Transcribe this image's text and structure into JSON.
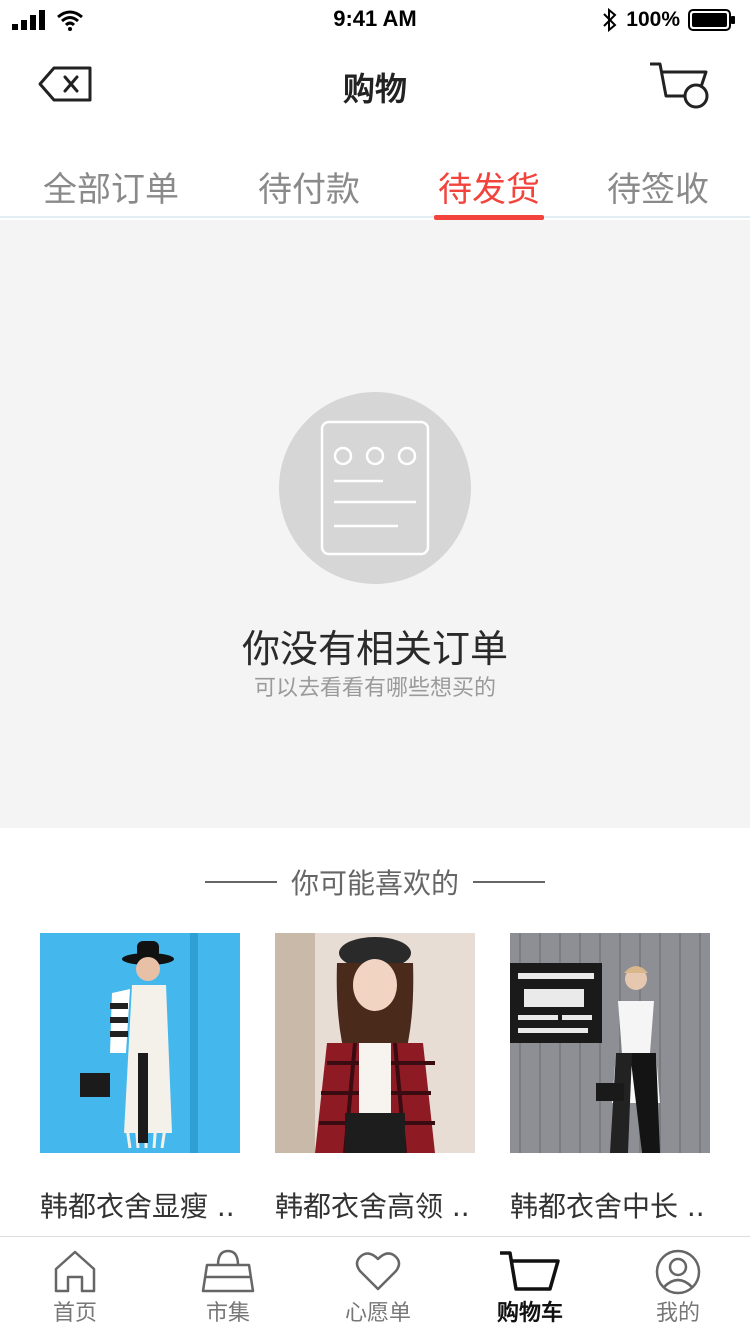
{
  "status_bar": {
    "time": "9:41 AM",
    "battery": "100%",
    "icons": [
      "signal-icon",
      "wifi-icon",
      "bluetooth-icon",
      "battery-icon"
    ]
  },
  "nav": {
    "title": "购物",
    "back_icon": "delete-back-icon",
    "cart_icon": "cart-icon"
  },
  "tabs": [
    {
      "label": "全部订单",
      "active": false
    },
    {
      "label": "待付款",
      "active": false
    },
    {
      "label": "待发货",
      "active": true
    },
    {
      "label": "待签收",
      "active": false
    }
  ],
  "empty": {
    "icon": "order-document-icon",
    "title": "你没有相关订单",
    "subtitle": "可以去看看有哪些想买的"
  },
  "recommend": {
    "title": "你可能喜欢的",
    "products": [
      {
        "name": "韩都衣舍显瘦 ..",
        "image": "fashion-photo-blue"
      },
      {
        "name": "韩都衣舍高领 ..",
        "image": "fashion-photo-plaid"
      },
      {
        "name": "韩都衣舍中长 ..",
        "image": "fashion-photo-coffee"
      }
    ]
  },
  "tabbar": [
    {
      "label": "首页",
      "icon": "home-icon",
      "active": false
    },
    {
      "label": "市集",
      "icon": "bag-icon",
      "active": false
    },
    {
      "label": "心愿单",
      "icon": "heart-icon",
      "active": false
    },
    {
      "label": "购物车",
      "icon": "cart-icon",
      "active": true
    },
    {
      "label": "我的",
      "icon": "user-icon",
      "active": false
    }
  ],
  "colors": {
    "accent": "#f2433c",
    "empty_bg": "#f4f4f4",
    "placeholder_circle": "#d6d6d6"
  }
}
